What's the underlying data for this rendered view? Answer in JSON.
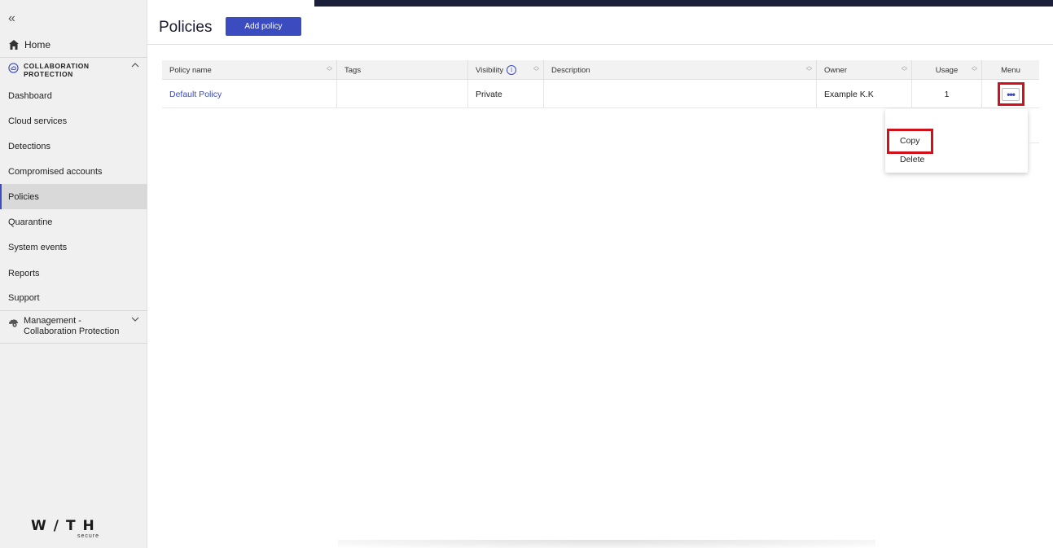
{
  "sidebar": {
    "collapse_glyph": "«",
    "home_label": "Home",
    "section_label_1": "COLLABORATION",
    "section_label_2": "PROTECTION",
    "items": [
      {
        "label": "Dashboard"
      },
      {
        "label": "Cloud services"
      },
      {
        "label": "Detections"
      },
      {
        "label": "Compromised accounts"
      },
      {
        "label": "Policies",
        "active": true
      },
      {
        "label": "Quarantine"
      },
      {
        "label": "System events"
      },
      {
        "label": "Reports"
      },
      {
        "label": "Support"
      }
    ],
    "management_label_1": "Management -",
    "management_label_2": "Collaboration Protection",
    "logo_word": "W/TH",
    "logo_sub": "secure"
  },
  "header": {
    "title": "Policies",
    "add_button_label": "Add policy"
  },
  "table": {
    "columns": [
      "Policy name",
      "Tags",
      "Visibility",
      "Description",
      "Owner",
      "Usage",
      "Menu"
    ],
    "rows": [
      {
        "policy_name": "Default Policy",
        "tags": "",
        "visibility": "Private",
        "description": "",
        "owner": "Example K.K",
        "usage": "1",
        "menu": "•••"
      }
    ]
  },
  "row_menu": {
    "items": [
      {
        "label": "Copy",
        "highlighted": true
      },
      {
        "label": "Delete"
      }
    ]
  },
  "colors": {
    "accent": "#3b4cc0",
    "highlight": "#d0101a",
    "topbar": "#1b1f3a"
  }
}
